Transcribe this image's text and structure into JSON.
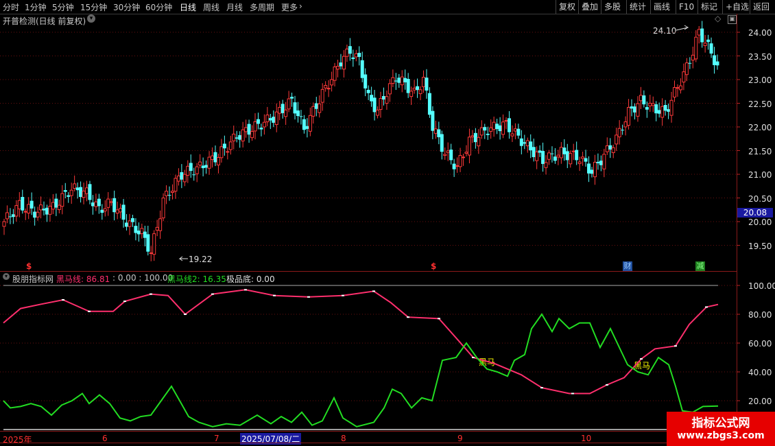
{
  "toolbar": {
    "periods": [
      "分时",
      "1分钟",
      "5分钟",
      "15分钟",
      "30分钟",
      "60分钟",
      "日线",
      "周线",
      "月线",
      "多周期",
      "更多"
    ],
    "active_period": "日线",
    "right_buttons": [
      "复权",
      "叠加",
      "多股",
      "统计",
      "画线",
      "F10",
      "标记",
      "+自选",
      "返回"
    ]
  },
  "main_chart": {
    "title": "开普检测(日线 前复权)",
    "price_axis": [
      "24.00",
      "23.50",
      "23.00",
      "22.50",
      "22.00",
      "21.50",
      "21.00",
      "20.50",
      "20.00",
      "19.50"
    ],
    "current_price": "20.08",
    "high_label": "24.10",
    "low_label": "19.22",
    "markers": [
      {
        "text": "$",
        "color": "#ff3030"
      },
      {
        "text": "$",
        "color": "#ff3030"
      },
      {
        "text": "财",
        "color": "#4aa0ff"
      },
      {
        "text": "减",
        "color": "#30ff30"
      }
    ]
  },
  "indicator": {
    "name": "股朋指标网",
    "line1_label": "黑马线: 86.81",
    "params": ": 0.00 : 100.00",
    "line2_label": "黑马线2: 16.35",
    "bottom_label": "极品底: 0.00",
    "axis": [
      "100.00",
      "80.00",
      "60.00",
      "40.00",
      "20.00"
    ],
    "signal_label": "黑马",
    "colors": {
      "line1": "#ff2f6d",
      "line2": "#22dd22",
      "signal": "#ffff00"
    }
  },
  "date_axis": {
    "labels": [
      "2025年",
      "6",
      "7",
      "2025/07/08/二",
      "8",
      "9",
      "10"
    ]
  },
  "watermark": {
    "title": "指标公式网",
    "url": "www.zbgs3.com"
  }
}
